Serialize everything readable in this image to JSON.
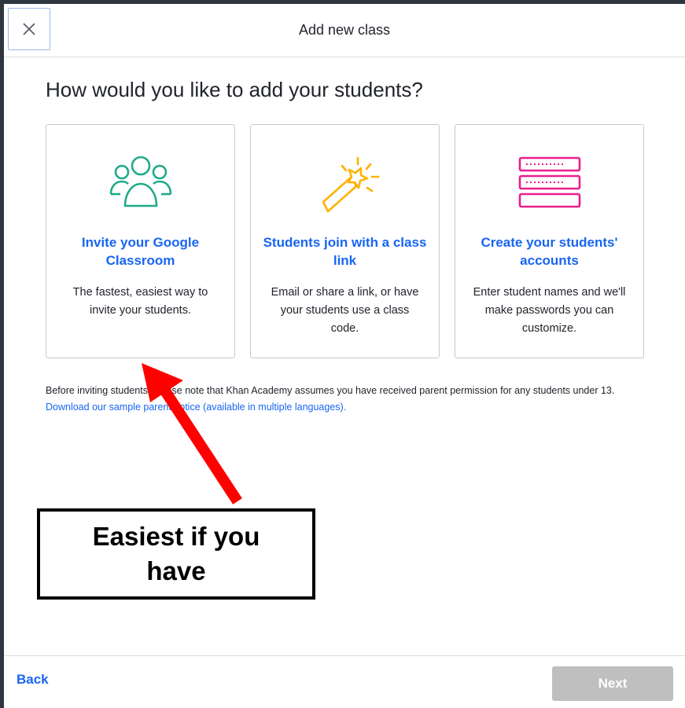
{
  "modal": {
    "title": "Add new class",
    "question": "How would you like to add your students?"
  },
  "cards": [
    {
      "icon": "students-group-icon",
      "title": "Invite your Google Classroom",
      "description": "The fastest, easiest way to invite your students.",
      "color": "#1fab8a"
    },
    {
      "icon": "magic-wand-icon",
      "title": "Students join with a class link",
      "description": "Email or share a link, or have your students use a class code.",
      "color": "#ffb100"
    },
    {
      "icon": "account-forms-icon",
      "title": "Create your students' accounts",
      "description": "Enter student names and we'll make passwords you can customize.",
      "color": "#e91e8c"
    }
  ],
  "notice": {
    "text_before": "Before inviting students, please note that Khan Academy assumes you have received parent permission for any students under 13. ",
    "link": "Download our sample parent notice (available in multiple languages)."
  },
  "footer": {
    "back_label": "Back",
    "next_label": "Next"
  },
  "annotation": {
    "callout_text": "Easiest if you have",
    "arrow_color": "#ff0000"
  },
  "colors": {
    "link_blue": "#1865f2",
    "disabled_gray": "#bfbfbf"
  }
}
